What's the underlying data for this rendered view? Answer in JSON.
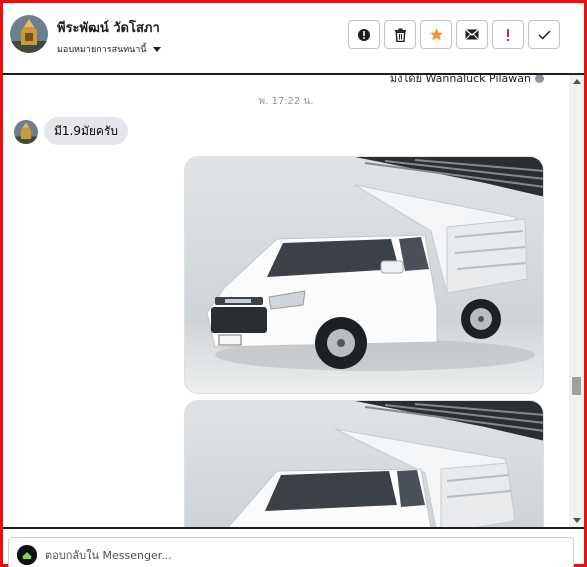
{
  "header": {
    "contact_name": "พีระพัฒน์ วัดโสภา",
    "assign_label": "มอบหมายการสนทนานี้",
    "actions": [
      {
        "icon": "alert-circle-icon",
        "label": "Mark as spam"
      },
      {
        "icon": "trash-icon",
        "label": "Delete"
      },
      {
        "icon": "star-icon",
        "label": "Follow up"
      },
      {
        "icon": "envelope-icon",
        "label": "Mark as unread"
      },
      {
        "icon": "exclamation-icon",
        "label": "Priority"
      },
      {
        "icon": "check-icon",
        "label": "Mark as done"
      }
    ]
  },
  "conversation": {
    "assigned_note": "มงโดย Wannaluck Pilawan",
    "timestamp": "พ. 17:22 น.",
    "messages": [
      {
        "type": "text",
        "sender": "contact",
        "text": "มี1.9มัยครับ"
      },
      {
        "type": "image",
        "sender": "page",
        "subject": "white pickup truck with dump bed"
      },
      {
        "type": "image",
        "sender": "page",
        "subject": "white pickup truck with dump bed"
      }
    ]
  },
  "reply": {
    "placeholder": "ตอบกลับใน Messenger..."
  },
  "colors": {
    "frame": "#e8100f",
    "star": "#f5922f",
    "exclamation": "#e41e3f",
    "bubble": "#e4e6eb"
  }
}
